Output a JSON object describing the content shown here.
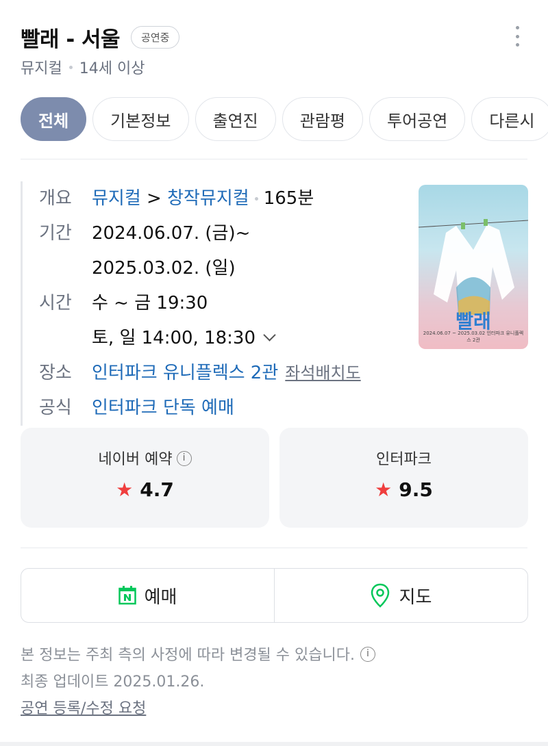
{
  "header": {
    "title": "빨래 - 서울",
    "status": "공연중",
    "genre": "뮤지컬",
    "age": "14세 이상"
  },
  "tabs": [
    {
      "label": "전체",
      "active": true
    },
    {
      "label": "기본정보"
    },
    {
      "label": "출연진"
    },
    {
      "label": "관람평"
    },
    {
      "label": "투어공연"
    },
    {
      "label": "다른시"
    }
  ],
  "info": {
    "overview_label": "개요",
    "overview_genre": "뮤지컬",
    "overview_arrow": ">",
    "overview_subgenre": "창작뮤지컬",
    "overview_runtime": "165분",
    "period_label": "기간",
    "period_start": "2024.06.07. (금)~",
    "period_end": "2025.03.02. (일)",
    "time_label": "시간",
    "time_weekday": "수 ~ 금 19:30",
    "time_weekend": "토, 일 14:00, 18:30",
    "venue_label": "장소",
    "venue": "인터파크 유니플렉스 2관",
    "seat_map": "좌석배치도",
    "official_label": "공식",
    "official": "인터파크 단독 예매"
  },
  "poster": {
    "title": "빨래",
    "dates": "2024.06.07 ~ 2025.03.02 인터파크 유니플렉스 2관"
  },
  "ratings": [
    {
      "source": "네이버 예약",
      "score": "4.7"
    },
    {
      "source": "인터파크",
      "score": "9.5"
    }
  ],
  "actions": {
    "booking": "예매",
    "map": "지도"
  },
  "footer": {
    "notice": "본 정보는 주최 측의 사정에 따라 변경될 수 있습니다.",
    "updated": "최종 업데이트 2025.01.26.",
    "request": "공연 등록/수정 요청"
  },
  "colors": {
    "accent": "#7d8cad",
    "link": "#1f6bb8",
    "star": "#ef3e3e",
    "naver_green": "#03c75a"
  }
}
